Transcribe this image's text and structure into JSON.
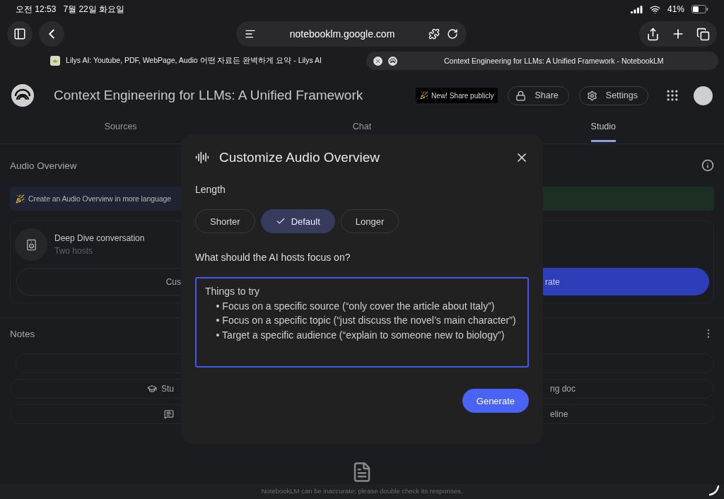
{
  "status_bar": {
    "time": "오전 12:53",
    "date": "7월 22일 화요일",
    "battery": "41%"
  },
  "browser": {
    "url": "notebooklm.google.com",
    "tabs": [
      {
        "title": "Lilys AI: Youtube, PDF, WebPage, Audio 어떤 자료든 완벽하게 요약 - Lilys AI",
        "selected": false
      },
      {
        "title": "Context Engineering for LLMs: A Unified Framework - NotebookLM",
        "selected": true
      }
    ]
  },
  "header": {
    "title": "Context Engineering for LLMs: A Unified Framework",
    "promo": "New! Share publicly",
    "share_button": "Share",
    "settings_button": "Settings"
  },
  "nav_tabs": [
    {
      "label": "Sources",
      "selected": false
    },
    {
      "label": "Chat",
      "selected": false
    },
    {
      "label": "Studio",
      "selected": true
    }
  ],
  "audio_overview": {
    "heading": "Audio Overview",
    "banner": "Create an Audio Overview in more language",
    "card_title": "Deep Dive conversation",
    "card_subtitle": "Two hosts",
    "buttons": [
      {
        "label": "Cus",
        "kind": "outline"
      },
      {
        "label": "rate",
        "kind": "filled"
      }
    ]
  },
  "notes": {
    "heading": "Notes",
    "rows": [
      {
        "kind": "wide"
      },
      {
        "kind": "split",
        "left": "Stu",
        "right": "ng doc"
      },
      {
        "kind": "split",
        "right": "eline"
      }
    ]
  },
  "modal": {
    "title": "Customize Audio Overview",
    "length_label": "Length",
    "length_options": [
      {
        "label": "Shorter",
        "selected": false
      },
      {
        "label": "Default",
        "selected": true
      },
      {
        "label": "Longer",
        "selected": false
      }
    ],
    "focus_label": "What should the AI hosts focus on?",
    "focus_field": {
      "placeholder": "Things to try\n\t• Focus on a specific source (“only cover the article about Italy”)\n\t• Focus on a specific topic (“just discuss the novel’s main character”)\n\t• Target a specific audience (“explain to someone new to biology”)"
    },
    "generate_button": "Generate"
  },
  "footer": "NotebookLM can be inaccurate; please double check its responses."
}
